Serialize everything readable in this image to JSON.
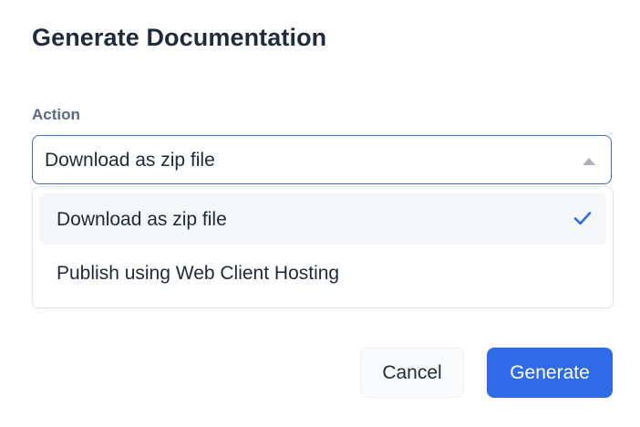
{
  "dialog": {
    "title": "Generate Documentation"
  },
  "action_field": {
    "label": "Action",
    "selected_value": "Download as zip file",
    "options": [
      {
        "label": "Download as zip file",
        "selected": true
      },
      {
        "label": "Publish using Web Client Hosting",
        "selected": false
      }
    ]
  },
  "buttons": {
    "cancel_label": "Cancel",
    "generate_label": "Generate"
  },
  "colors": {
    "accent": "#2f6be8",
    "select_border": "#3b6fb6",
    "selected_option_bg": "#f4f6fa",
    "check": "#2f6be8"
  },
  "icons": {
    "caret": "caret-up-icon",
    "check": "checkmark-icon"
  }
}
